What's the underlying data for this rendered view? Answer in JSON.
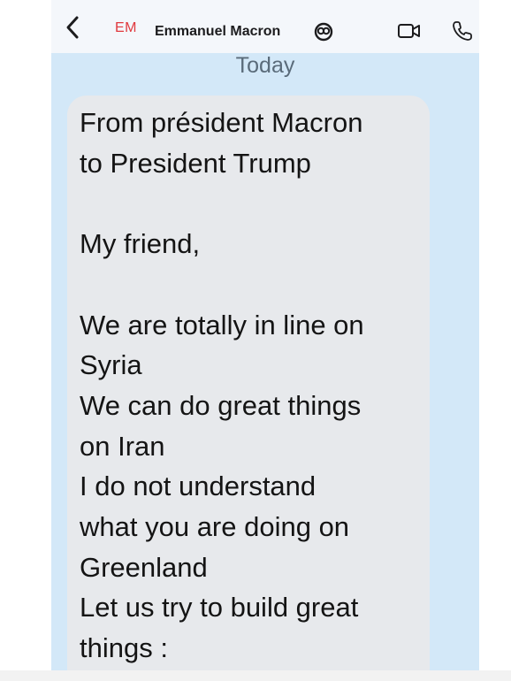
{
  "header": {
    "back_icon": "chevron-left-icon",
    "avatar_initials": "EM",
    "contact_name": "Emmanuel Macron",
    "badge_icon": "contact-badge-icon",
    "video_icon": "video-camera-icon",
    "call_icon": "phone-icon"
  },
  "conversation": {
    "date": "Today",
    "message": {
      "text": "From président Macron\nto President Trump\n\nMy friend,\n\nWe are totally in line on\nSyria\nWe can do great things\non Iran\nI do not understand\nwhat you are doing on\nGreenland\nLet us try to build great\nthings :"
    }
  },
  "colors": {
    "chat_background": "#d3e8f8",
    "bubble": "#e7e9ec",
    "initials": "#e0393e",
    "header": "#f4f7fb"
  }
}
